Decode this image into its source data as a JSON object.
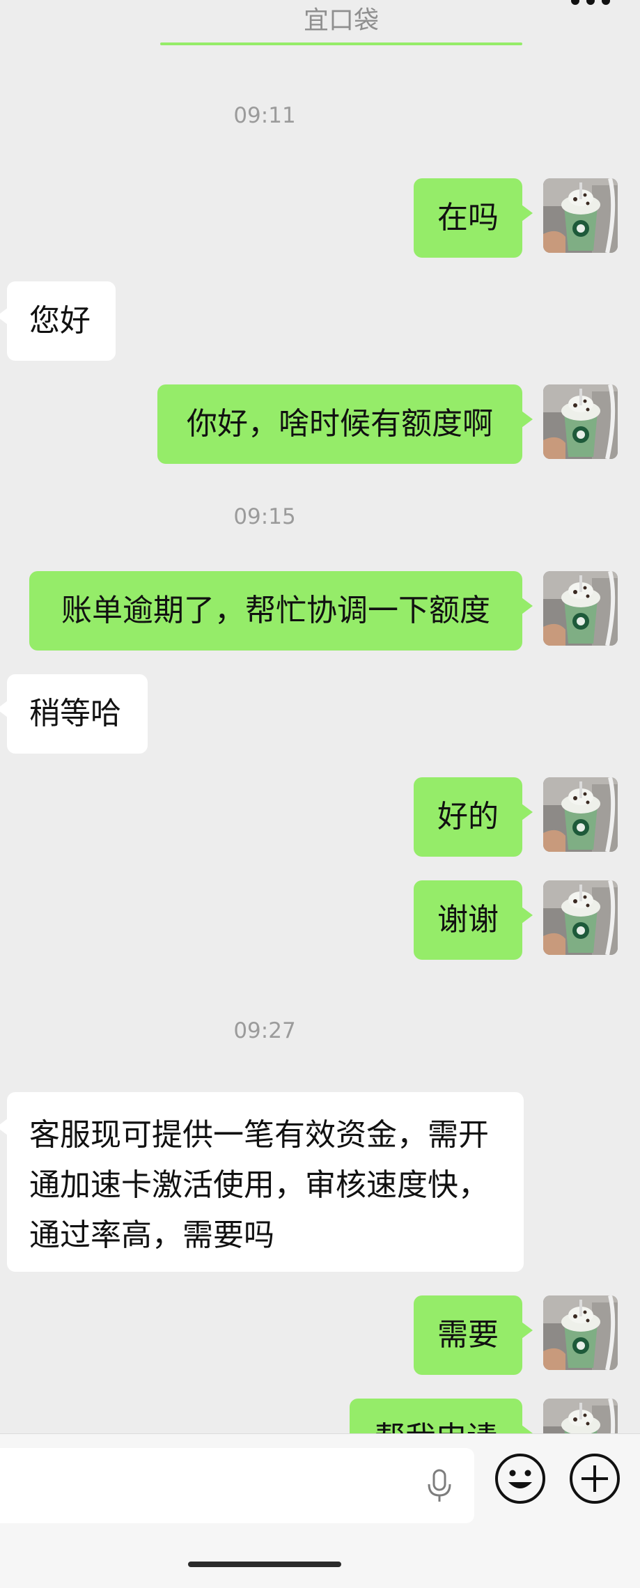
{
  "header": {
    "contact_name": "宜口袋",
    "more_icon": "more-dots-icon"
  },
  "colors": {
    "background": "#ededed",
    "sent_bubble": "#95ec69",
    "received_bubble": "#ffffff"
  },
  "messages": [
    {
      "type": "time",
      "text": "09:11"
    },
    {
      "type": "sent",
      "text": "在吗"
    },
    {
      "type": "received",
      "text": "您好"
    },
    {
      "type": "sent",
      "text": "你好，啥时候有额度啊"
    },
    {
      "type": "time",
      "text": "09:15"
    },
    {
      "type": "sent",
      "text": "账单逾期了，帮忙协调一下额度"
    },
    {
      "type": "received",
      "text": "稍等哈"
    },
    {
      "type": "sent",
      "text": "好的"
    },
    {
      "type": "sent",
      "text": "谢谢"
    },
    {
      "type": "time",
      "text": "09:27"
    },
    {
      "type": "received",
      "text": "客服现可提供一笔有效资金，需开通加速卡激活使用，审核速度快，通过率高，需要吗"
    },
    {
      "type": "sent",
      "text": "需要"
    },
    {
      "type": "sent",
      "text": "帮我申请"
    }
  ],
  "input_bar": {
    "voice_icon": "microphone-icon",
    "emoji_icon": "smiley-face-icon",
    "plus_icon": "plus-circle-icon"
  }
}
